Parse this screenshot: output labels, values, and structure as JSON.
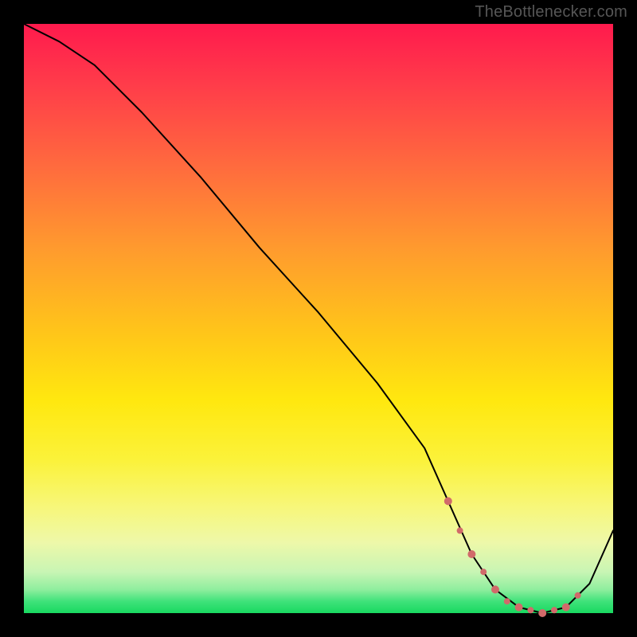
{
  "attribution": "TheBottlenecker.com",
  "colors": {
    "frame": "#000000",
    "curve": "#000000",
    "marker": "#d16a6a",
    "gradient_top": "#ff1a4d",
    "gradient_mid": "#ffe80f",
    "gradient_bottom": "#18d860"
  },
  "chart_data": {
    "type": "line",
    "title": "",
    "xlabel": "",
    "ylabel": "",
    "xlim": [
      0,
      100
    ],
    "ylim": [
      0,
      100
    ],
    "series": [
      {
        "name": "bottleneck-curve",
        "x": [
          0,
          6,
          12,
          20,
          30,
          40,
          50,
          60,
          68,
          72,
          76,
          80,
          84,
          88,
          92,
          96,
          100
        ],
        "values": [
          100,
          97,
          93,
          85,
          74,
          62,
          51,
          39,
          28,
          19,
          10,
          4,
          1,
          0,
          1,
          5,
          14
        ]
      }
    ],
    "markers": {
      "name": "highlighted-range",
      "x": [
        72,
        74,
        76,
        78,
        80,
        82,
        84,
        86,
        88,
        90,
        92,
        94
      ],
      "values": [
        19,
        14,
        10,
        7,
        4,
        2,
        1,
        0.5,
        0,
        0.5,
        1,
        3
      ],
      "size_pattern": [
        5,
        4,
        5,
        4,
        5,
        4,
        5,
        4,
        5,
        4,
        5,
        4
      ]
    }
  }
}
